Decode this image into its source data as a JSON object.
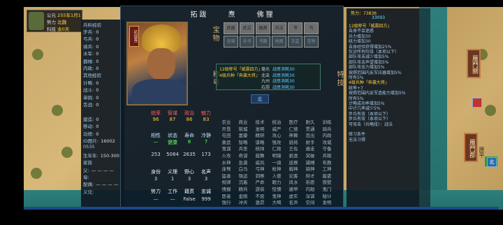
{
  "status": {
    "era_label": "公元",
    "year": "255年1月1",
    "force_label": "势力",
    "force_value": "北魏",
    "tech_label": "科技",
    "tech_value": "余0天"
  },
  "left_stats": {
    "header": "兵料经验",
    "items": [
      {
        "label": "步兵:",
        "value": "0"
      },
      {
        "label": "弓兵:",
        "value": "0"
      },
      {
        "label": "骑兵:",
        "value": "0"
      },
      {
        "label": "水军:",
        "value": "0"
      },
      {
        "label": "器械:",
        "value": "0"
      },
      {
        "label": "内政:",
        "value": "0"
      },
      {
        "label": "其他经验",
        "value": ""
      },
      {
        "label": "计略:",
        "value": "0"
      },
      {
        "label": "战斗:",
        "value": "0"
      },
      {
        "label": "单挑:",
        "value": "0"
      },
      {
        "label": "舌战:",
        "value": "0"
      },
      {
        "label": "",
        "value": ""
      },
      {
        "label": "建造:",
        "value": "0"
      },
      {
        "label": "移动:",
        "value": "0"
      },
      {
        "label": "功绩:",
        "value": "0"
      },
      {
        "label": "ID图片:",
        "value": "16002"
      },
      {
        "label": "0535",
        "value": ""
      },
      {
        "label": "生年年:",
        "value": "150-300"
      },
      {
        "label": "家族",
        "value": ""
      },
      {
        "label": "父:",
        "value": "— — — —"
      },
      {
        "label": "母:",
        "value": ""
      },
      {
        "label": "配偶:",
        "value": "— — — —"
      },
      {
        "label": "义兄:",
        "value": ""
      }
    ]
  },
  "dialog": {
    "name_parts": [
      "拓跋",
      "焘",
      "佛狸"
    ],
    "portrait_tag": "拓跋焘",
    "label_treasure": "宝物",
    "label_title": "称号",
    "label_skill": "特技",
    "treasure_buttons": [
      "武器",
      "武式",
      "器具",
      "兵法",
      "书",
      "马",
      "坐骑",
      "兵书",
      "书籍",
      "地图",
      "玉玺",
      "宝物"
    ],
    "titles": [
      {
        "k": "12级称号『威震四方』",
        "e": "战意消耗30"
      },
      {
        "k": "4级兵种『奔袭大将』",
        "e": "战意消耗30"
      },
      {
        "k": "",
        "e": "战意消耗30"
      },
      {
        "k": "",
        "e": "战意消耗30"
      }
    ],
    "title_keys": [
      "毫光",
      "北击",
      "九州",
      "石郑"
    ],
    "tabs": [
      "北",
      "",
      "",
      ""
    ],
    "stat_headers": [
      "统率",
      "智谋",
      "政治",
      "魅力"
    ],
    "stat_values": [
      "96",
      "87",
      "86",
      "83"
    ],
    "sub_headers": [
      "相性",
      "状态",
      "寿命",
      "冷静"
    ],
    "sub_values": [
      "—",
      "健康",
      "8",
      "7"
    ],
    "num_row": [
      "253",
      "5084",
      "2635",
      "173"
    ],
    "misc_headers": [
      "身份",
      "义理",
      "野心",
      "名声"
    ],
    "misc_values": [
      "3",
      "1",
      "3",
      "3"
    ],
    "bottom_headers": [
      "势力",
      "工作",
      "籍贯",
      "忠诚"
    ],
    "bottom_values": [
      "—",
      "—",
      "False",
      "999"
    ],
    "skills": [
      "农业",
      "商业",
      "技术",
      "统治",
      "医疗",
      "耐久",
      "训练",
      "开垦",
      "筑城",
      "发明",
      "威严",
      "仁德",
      "贯通",
      "骑兵",
      "屯田",
      "富豪",
      "精研",
      "攻心",
      "神算",
      "百出",
      "内政",
      "勇武",
      "智略",
      "谋略",
      "强攻",
      "骁将",
      "射手",
      "攻城",
      "鬼谋",
      "兵圣",
      "统帅",
      "仁政",
      "王佐",
      "遁走",
      "守备",
      "火攻",
      "奇谋",
      "鼓舞",
      "明镜",
      "驱逐",
      "突破",
      "兵粮",
      "水神",
      "急袭",
      "威风",
      "一骑",
      "巡察",
      "捕缚",
      "布教",
      "连弩",
      "白马",
      "弓神",
      "枪神",
      "戟神",
      "骑神",
      "工神",
      "猛者",
      "强运",
      "洞察",
      "人徳",
      "论客",
      "辩才",
      "能吏",
      "规律",
      "沉着",
      "严命",
      "眼力",
      "风水",
      "祈愿",
      "铁壁",
      "情报",
      "精兵",
      "游侠",
      "怯懦",
      "遁甲",
      "内助",
      "鬼门",
      "医者",
      "金刚",
      "不屈",
      "鬼神",
      "虚实",
      "深谋",
      "秘计",
      "强行",
      "冲天",
      "激昂",
      "大喝",
      "名声",
      "空间",
      "发明"
    ]
  },
  "right_panel": {
    "force_label": "势力",
    "force_value": "73836",
    "force_sub": "33093",
    "lines": [
      {
        "t": "12级称号『威震四方』",
        "c": "y"
      },
      {
        "t": "自身不会迷惑",
        "c": ""
      },
      {
        "t": "兵力增加30",
        "c": ""
      },
      {
        "t": "统力增加30",
        "c": ""
      },
      {
        "t": "自身经验获得增加25%",
        "c": ""
      },
      {
        "t": "仅对所有阶段（本项以下）",
        "c": ""
      },
      {
        "t": "部队攻击减少增加5%",
        "c": ""
      },
      {
        "t": "部队攻击声望增加5%",
        "c": ""
      },
      {
        "t": "部队攻击力增加5%",
        "c": ""
      },
      {
        "t": "按照范围内友军应器增加5%",
        "c": ""
      },
      {
        "t": "所有5%",
        "c": ""
      },
      {
        "t": "4级兵种『奔袭大将』",
        "c": "y"
      },
      {
        "t": "统率+7",
        "c": ""
      },
      {
        "t": "按照范围内友军造能力增加5%",
        "c": ""
      },
      {
        "t": "所有5%",
        "c": ""
      },
      {
        "t": "计略成功率增加5%",
        "c": ""
      },
      {
        "t": "中计几率减少5%",
        "c": ""
      },
      {
        "t": "步兵有效（本项以下）",
        "c": ""
      },
      {
        "t": "步兵有效（本项以下）",
        "c": ""
      },
      {
        "t": "可攻击（兵略段）：战法",
        "c": ""
      },
      {
        "t": "",
        "c": ""
      },
      {
        "t": "修习条件",
        "c": ""
      },
      {
        "t": "无法习得",
        "c": ""
      }
    ]
  },
  "map": {
    "city1": "雁門關",
    "city2": "雁門郡",
    "city2_sub": "原平",
    "north_tag": "北"
  }
}
